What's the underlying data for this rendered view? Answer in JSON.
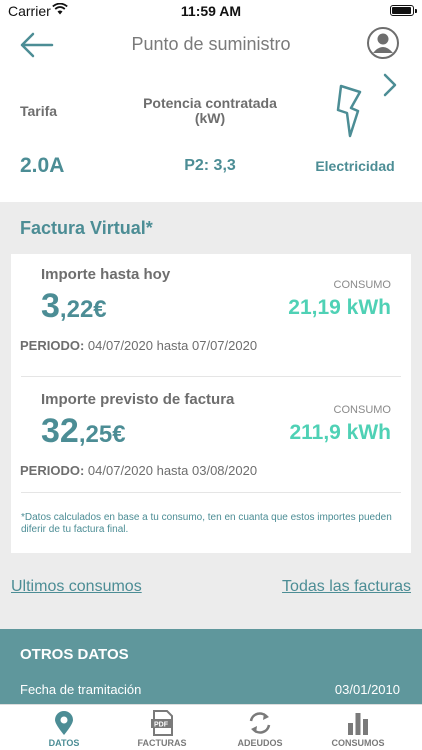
{
  "status_bar": {
    "carrier": "Carrier",
    "time": "11:59 AM",
    "battery_level": 0.95
  },
  "nav": {
    "title": "Punto de suministro"
  },
  "supply": {
    "tarifa_label": "Tarifa",
    "potencia_label": "Potencia contratada\n(kW)",
    "tarifa_value": "2.0A",
    "potencia_value": "P2: 3,3",
    "tipo_value": "Electricidad"
  },
  "factura": {
    "title": "Factura Virtual*",
    "current": {
      "heading": "Importe hasta hoy",
      "amount_int": "3",
      "amount_dec": ",22€",
      "consumo_label": "CONSUMO",
      "consumo_value": "21,19 kWh",
      "period_label": "PERIODO:",
      "period_value": " 04/07/2020 hasta 07/07/2020"
    },
    "forecast": {
      "heading": "Importe previsto de factura",
      "amount_int": "32",
      "amount_dec": ",25€",
      "consumo_label": "CONSUMO",
      "consumo_value": "211,9 kWh",
      "period_label": "PERIODO:",
      "period_value": " 04/07/2020 hasta 03/08/2020"
    },
    "disclaimer": "*Datos calculados en base a tu consumo, ten en cuanta que estos importes pueden diferir de tu factura final."
  },
  "links": {
    "consumos": "Ultimos consumos",
    "facturas": "Todas las facturas"
  },
  "otros": {
    "title": "OTROS DATOS",
    "row_label": "Fecha de tramitación",
    "row_value": "03/01/2010"
  },
  "tabs": [
    {
      "label": "DATOS",
      "icon": "location-pin-icon",
      "active": true
    },
    {
      "label": "FACTURAS",
      "icon": "pdf-icon",
      "active": false
    },
    {
      "label": "ADEUDOS",
      "icon": "refresh-icon",
      "active": false
    },
    {
      "label": "CONSUMOS",
      "icon": "bar-chart-icon",
      "active": false
    }
  ],
  "colors": {
    "accent": "#4c8d95",
    "consumo": "#4fd1b5",
    "otros_bg": "#5f979c"
  }
}
